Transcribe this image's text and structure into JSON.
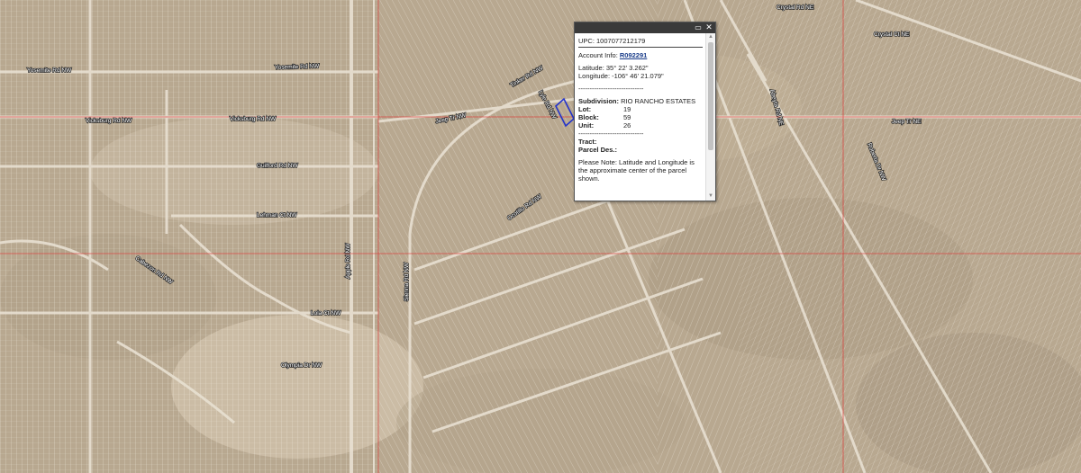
{
  "popup": {
    "upc_label": "UPC:",
    "upc_value": "1007077212179",
    "account_label": "Account Info:",
    "account_value": "R092291",
    "latitude_label": "Latitude:",
    "latitude_value": "35° 22' 3.262\"",
    "longitude_label": "Longitude:",
    "longitude_value": "-106° 46' 21.079\"",
    "separator": "-----------------------------",
    "subdivision_label": "Subdivision:",
    "subdivision_value": "RIO RANCHO ESTATES",
    "lot_label": "Lot:",
    "lot_value": "19",
    "block_label": "Block:",
    "block_value": "59",
    "unit_label": "Unit:",
    "unit_value": "26",
    "tract_label": "Tract:",
    "parcel_label": "Parcel Des.:",
    "note": "Please Note: Latitude and Longitude is the approximate center of the parcel shown.",
    "maximize_icon": "maximize-icon",
    "close_icon": "close-icon"
  },
  "colors": {
    "terrain": "#b8a890",
    "parcel_lines": "#f2ece2",
    "boundary": "#e03030",
    "selected_parcel": "#2233cc",
    "popup_header": "#3a3a3a"
  },
  "street_labels": [
    "Yosemite Rd NW",
    "Vicksburg Rd NW",
    "Guilford Rd NW",
    "Lehman Ct NW",
    "Cabezon Rd NW",
    "Lola Ct NW",
    "Olympia Dr NW",
    "Apple Rd NW",
    "Jeep Tr NW",
    "Sienna Rd NW",
    "Ocotillo Rd NW",
    "Tinker Rd NW",
    "Lyle Rd NW",
    "Jeep Tr NE",
    "Crystal Rd NE",
    "Crystal Ct NE",
    "Abeyta Rd NE",
    "Roberta Dr NW"
  ]
}
